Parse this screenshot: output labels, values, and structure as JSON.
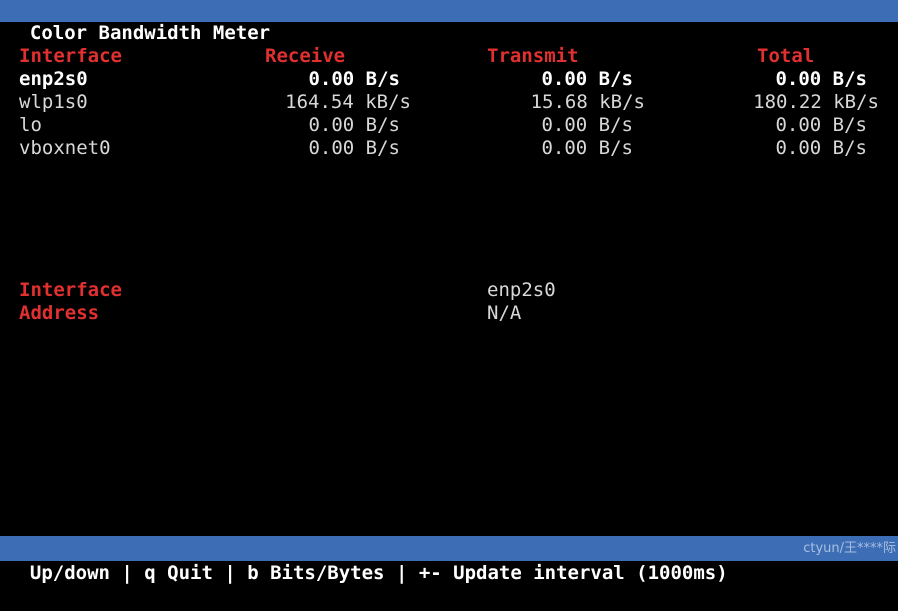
{
  "window": {
    "title": "Color Bandwidth Meter"
  },
  "table": {
    "headers": {
      "interface": "Interface",
      "receive": "Receive",
      "transmit": "Transmit",
      "total": "Total"
    },
    "rows": [
      {
        "name": "enp2s0",
        "receive": "0.00 B/s",
        "transmit": "0.00 B/s",
        "total": "0.00 B/s",
        "selected": true
      },
      {
        "name": "wlp1s0",
        "receive": "164.54 kB/s",
        "transmit": "15.68 kB/s",
        "total": "180.22 kB/s",
        "selected": false
      },
      {
        "name": "lo",
        "receive": "0.00 B/s",
        "transmit": "0.00 B/s",
        "total": "0.00 B/s",
        "selected": false
      },
      {
        "name": "vboxnet0",
        "receive": "0.00 B/s",
        "transmit": "0.00 B/s",
        "total": "0.00 B/s",
        "selected": false
      }
    ]
  },
  "details": {
    "interface_label": "Interface",
    "interface_value": "enp2s0",
    "address_label": "Address",
    "address_value": "N/A"
  },
  "statusbar": {
    "text": "Up/down | q Quit | b Bits/Bytes | +- Update interval (1000ms)",
    "watermark": "ctyun/王****际"
  },
  "colors": {
    "bar_background": "#3d6db5",
    "header_text": "#e03030",
    "background": "#000000"
  }
}
